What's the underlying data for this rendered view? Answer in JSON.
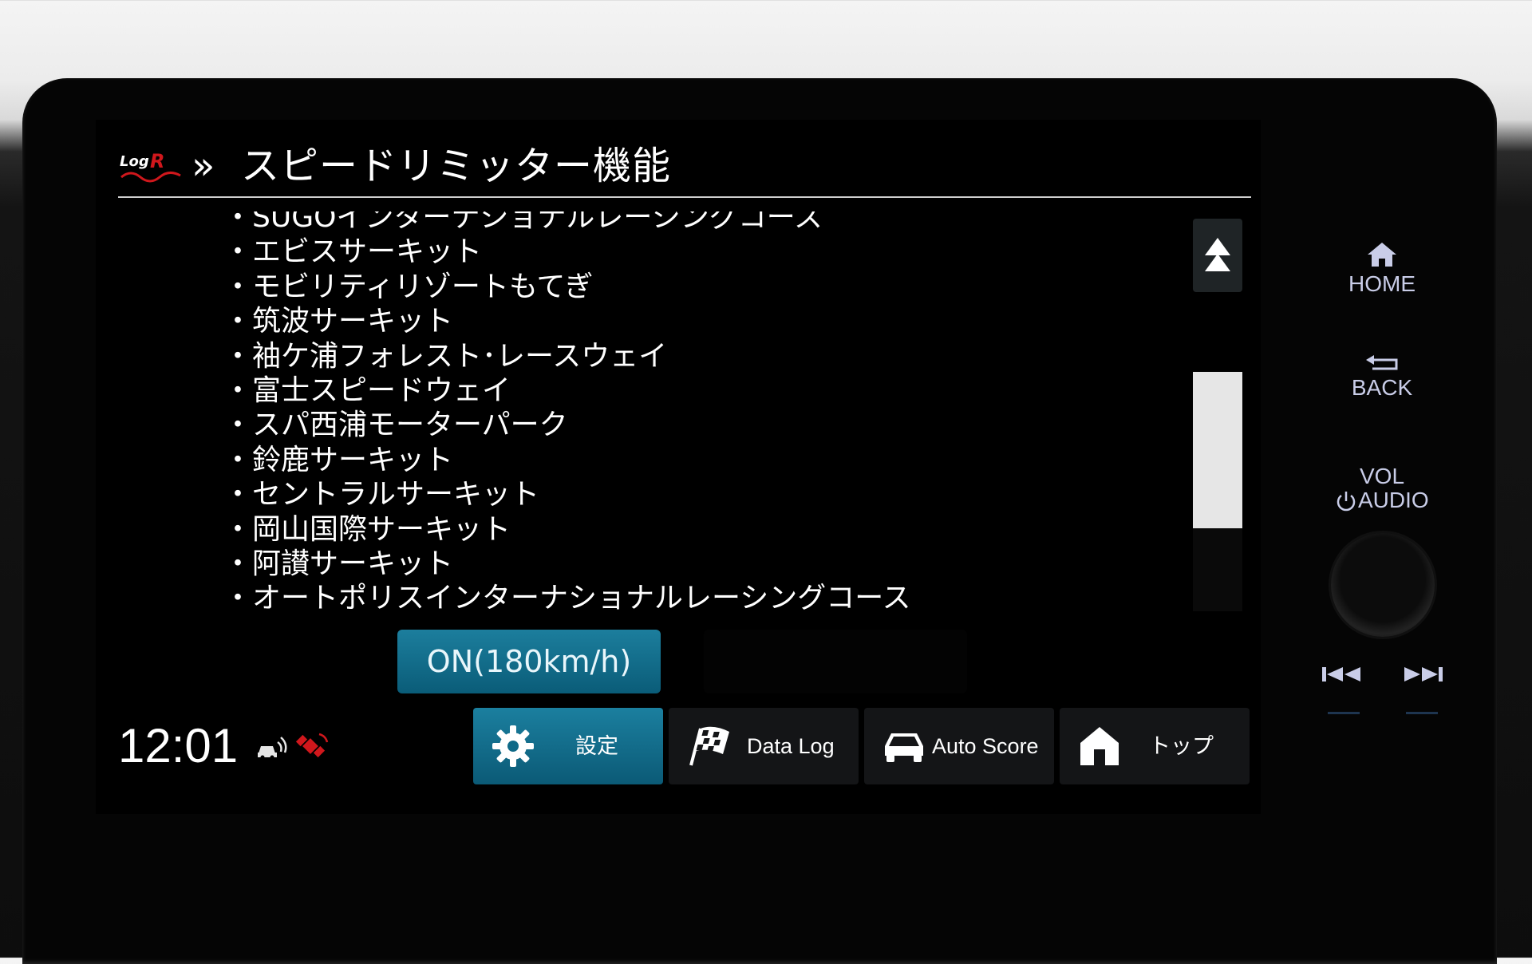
{
  "header": {
    "logo_text": "LogR",
    "title": "スピードリミッター機能"
  },
  "circuits": [
    "・SUGOインターナショナルレーシングコース",
    "・エビスサーキット",
    "・モビリティリゾートもてぎ",
    "・筑波サーキット",
    "・袖ケ浦フォレスト･レースウェイ",
    "・富士スピードウェイ",
    "・スパ西浦モーターパーク",
    "・鈴鹿サーキット",
    "・セントラルサーキット",
    "・岡山国際サーキット",
    "・阿讃サーキット",
    "・オートポリスインターナショナルレーシングコース"
  ],
  "limiter": {
    "on_label": "ON(180km/h)"
  },
  "status": {
    "time": "12:01"
  },
  "tabs": [
    {
      "label": "設定",
      "icon": "gear-icon",
      "active": true
    },
    {
      "label": "Data Log",
      "icon": "checkered-flag-icon",
      "active": false
    },
    {
      "label": "Auto Score",
      "icon": "car-icon",
      "active": false
    },
    {
      "label": "トップ",
      "icon": "home-icon",
      "active": false
    }
  ],
  "hardkeys": {
    "home": "HOME",
    "back": "BACK",
    "vol": "VOL",
    "audio": "AUDIO"
  },
  "colors": {
    "accent": "#1b7f9f",
    "alert": "#d0171c",
    "hardkey": "#c9cde8"
  }
}
